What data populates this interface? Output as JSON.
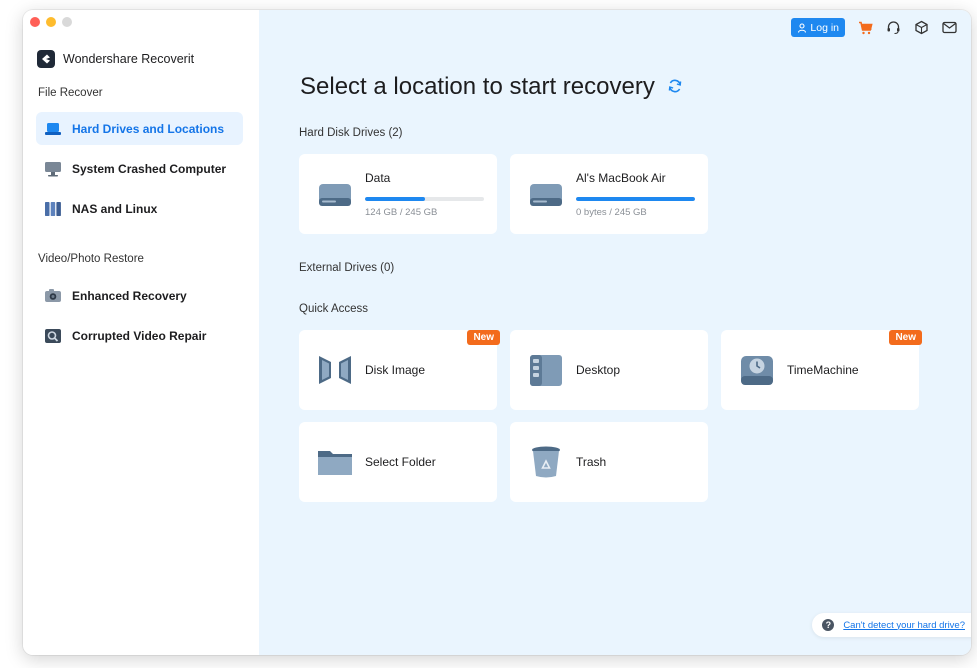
{
  "app": {
    "name": "Wondershare Recoverit"
  },
  "sidebar": {
    "file_recover_label": "File Recover",
    "file_items": [
      {
        "label": "Hard Drives and Locations",
        "icon": "hard-drive-icon",
        "active": true
      },
      {
        "label": "System Crashed Computer",
        "icon": "monitor-icon",
        "active": false
      },
      {
        "label": "NAS and Linux",
        "icon": "nas-icon",
        "active": false
      }
    ],
    "video_label": "Video/Photo Restore",
    "video_items": [
      {
        "label": "Enhanced Recovery",
        "icon": "camera-icon"
      },
      {
        "label": "Corrupted Video Repair",
        "icon": "video-repair-icon"
      }
    ]
  },
  "topbar": {
    "login_label": "Log in"
  },
  "main": {
    "title": "Select a location to start recovery",
    "hard_disk_label": "Hard Disk Drives (2)",
    "drives": [
      {
        "name": "Data",
        "size": "124 GB / 245 GB",
        "used_fraction": 0.5
      },
      {
        "name": "Al's MacBook Air",
        "size": "0 bytes / 245 GB",
        "used_fraction": 1.0
      }
    ],
    "external_label": "External Drives (0)",
    "quick_access_label": "Quick Access",
    "quick_access": [
      {
        "name": "Disk Image",
        "icon": "disk-image-icon",
        "badge": "New"
      },
      {
        "name": "Desktop",
        "icon": "desktop-folder-icon",
        "badge": ""
      },
      {
        "name": "TimeMachine",
        "icon": "time-machine-icon",
        "badge": "New"
      },
      {
        "name": "Select Folder",
        "icon": "folder-icon",
        "badge": ""
      },
      {
        "name": "Trash",
        "icon": "trash-icon",
        "badge": ""
      }
    ],
    "help_link": "Can't detect your hard drive?"
  },
  "colors": {
    "accent": "#1e88f0",
    "badge": "#f36b1c",
    "main_bg": "#eaf5fe",
    "active_bg": "#e8f3ff"
  }
}
